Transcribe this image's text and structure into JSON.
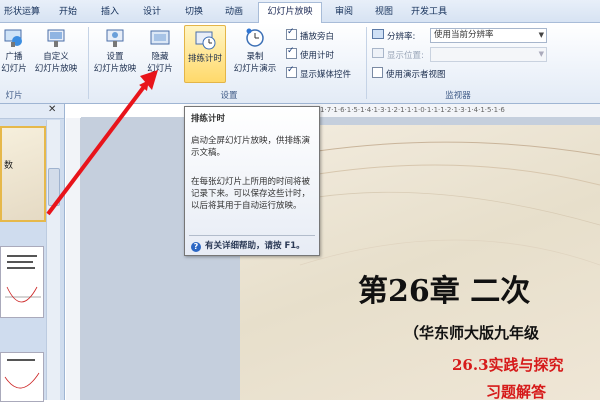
{
  "tabs": [
    "形状运算",
    "开始",
    "插入",
    "设计",
    "切换",
    "动画",
    "幻灯片放映",
    "审阅",
    "视图",
    "开发工具"
  ],
  "active_tab": "幻灯片放映",
  "ribbon": {
    "left_partial": {
      "broadcast": "广播",
      "broadcast2": "幻灯片",
      "custom": "自定义",
      "custom2": "幻灯片放映",
      "group_label": "灯片"
    },
    "setup_group": {
      "label": "设置",
      "setup_show": {
        "line1": "设置",
        "line2": "幻灯片放映"
      },
      "hide_slide": {
        "line1": "隐藏",
        "line2": "幻灯片"
      },
      "rehearse": {
        "label": "排练计时"
      },
      "record": {
        "line1": "录制",
        "line2": "幻灯片演示"
      },
      "checkboxes": [
        {
          "label": "播放旁白",
          "checked": true
        },
        {
          "label": "使用计时",
          "checked": true
        },
        {
          "label": "显示媒体控件",
          "checked": true
        }
      ]
    },
    "monitor_group": {
      "label": "监视器",
      "resolution_label": "分辨率:",
      "resolution_value": "使用当前分辨率",
      "show_on_label": "显示位置:",
      "presenter_view": "使用演示者视图"
    }
  },
  "tooltip": {
    "title": "排练计时",
    "p1": "启动全屏幻灯片放映，供排练演示文稿。",
    "p2": "在每张幻灯片上所用的时间将被记录下来。可以保存这些计时，以后将其用于自动运行放映。",
    "help": "有关详细帮助，请按 F1。"
  },
  "slide": {
    "title": "第26章  二次",
    "subtitle": "（华东师大版九年级",
    "section": "26.3实践与探究",
    "exercise": "习题解答"
  },
  "thumbnails": {
    "t1_text": "数"
  },
  "ruler_text": "9·1·8·1·7·1·6·1·5·1·4·1·3·1·2·1·1·1·0·1·1·1·2·1·3·1·4·1·5·1·6"
}
